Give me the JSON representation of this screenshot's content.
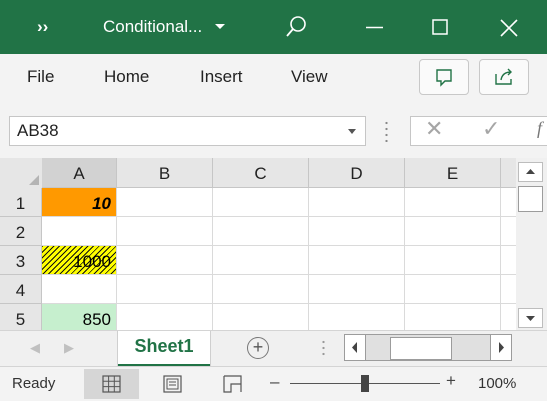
{
  "title_bar": {
    "overflow": "››",
    "document_title": "Conditional...",
    "background": "#217346"
  },
  "ribbon": {
    "menu": [
      "File",
      "Home",
      "Insert",
      "View"
    ]
  },
  "formula_bar": {
    "name_box": "AB38",
    "cancel_symbol": "✕",
    "enter_symbol": "✓",
    "fx_symbol": "f"
  },
  "grid": {
    "column_headers": [
      "A",
      "B",
      "C",
      "D",
      "E"
    ],
    "row_headers": [
      "1",
      "2",
      "3",
      "4",
      "5"
    ],
    "cells": {
      "A1": "10",
      "A3": "1000",
      "A5": "850"
    },
    "colors": {
      "A1_fill": "#ff9900",
      "A3_fill": "#ffff00",
      "A5_fill": "#c6efce"
    }
  },
  "sheet_tabs": {
    "active": "Sheet1",
    "add_symbol": "+"
  },
  "status_bar": {
    "status": "Ready",
    "zoom_minus": "–",
    "zoom_plus": "+",
    "zoom": "100%"
  }
}
